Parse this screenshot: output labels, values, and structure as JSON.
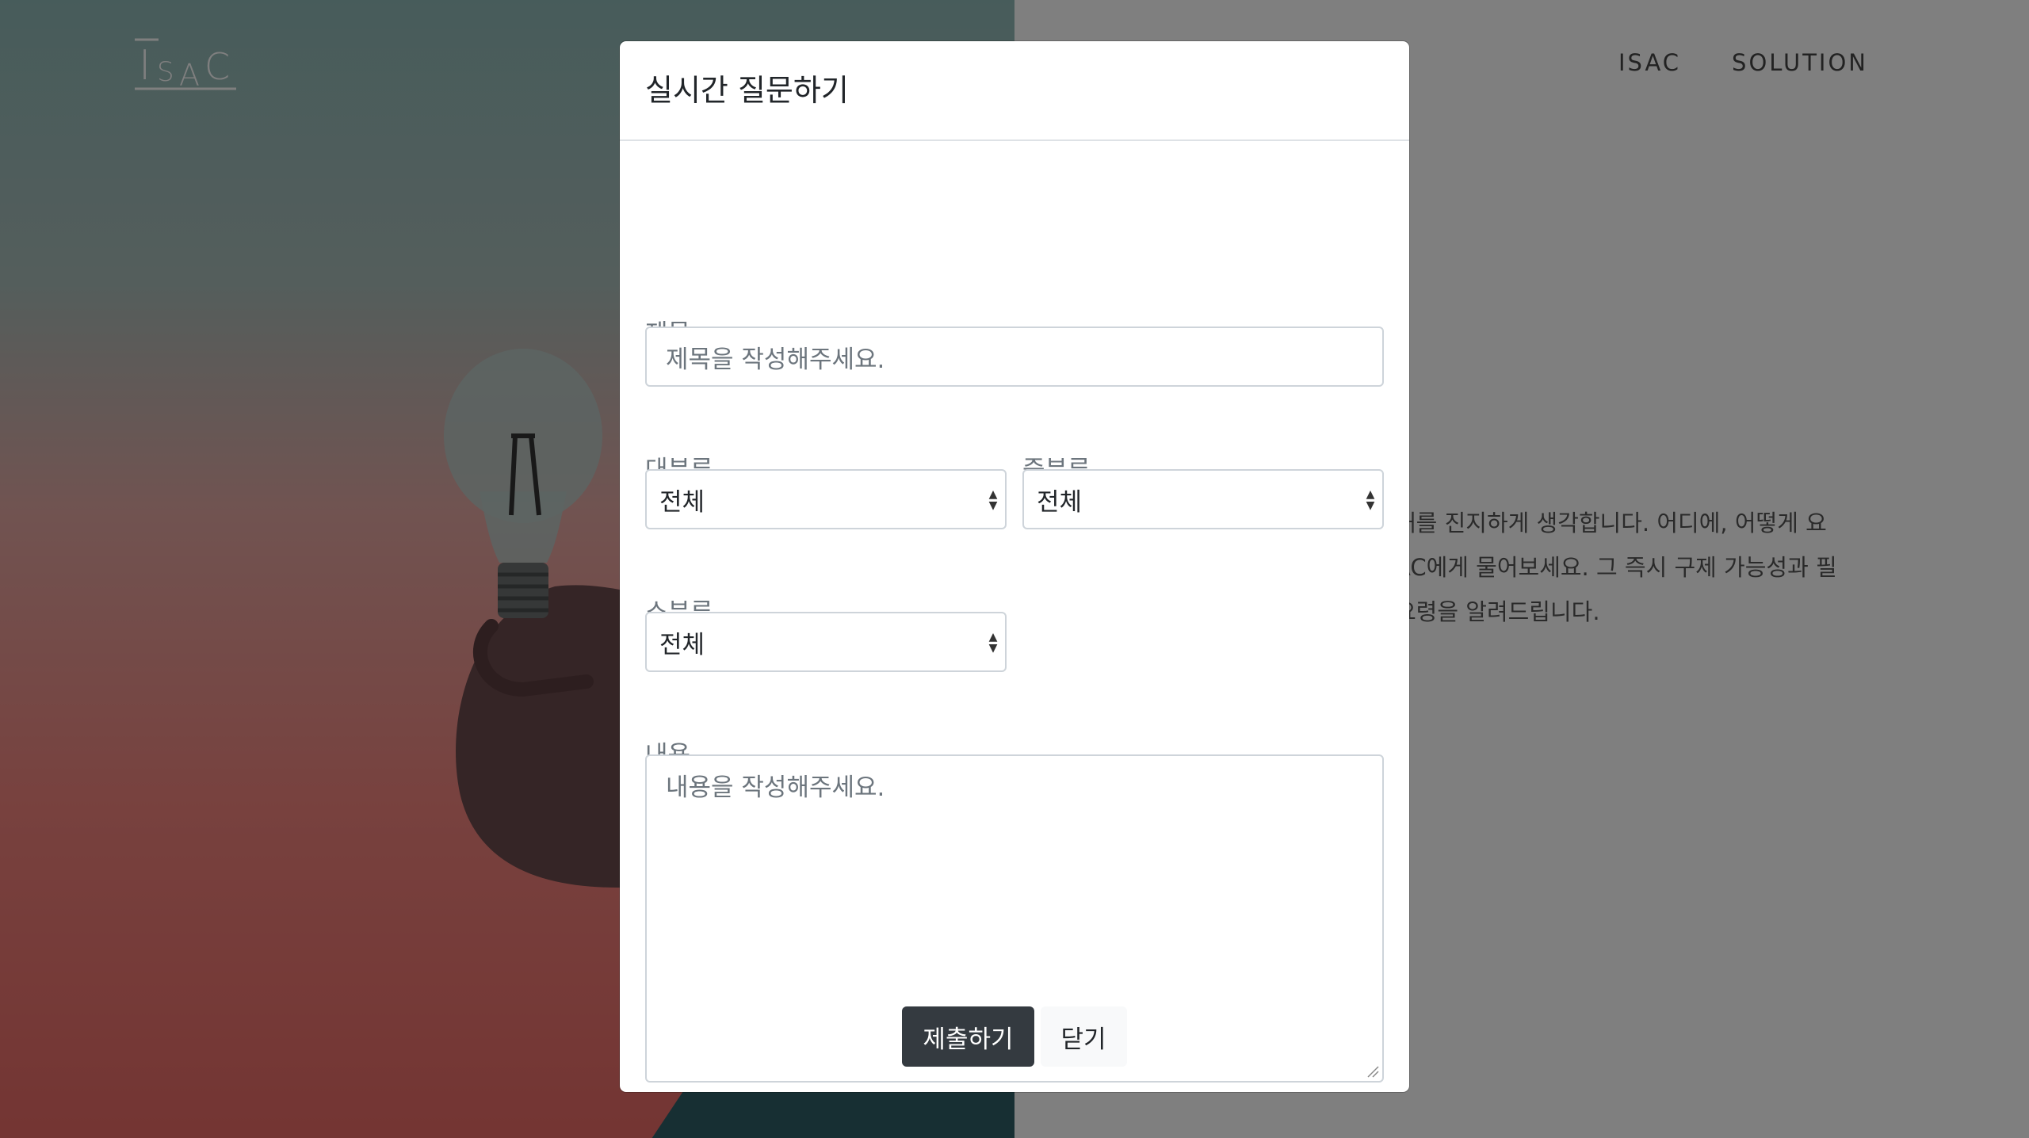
{
  "site": {
    "logo_text": "ISAC",
    "nav": [
      "ISAC",
      "SOLUTION"
    ],
    "hero_lines": [
      "해를 진지하게 생각합니다. 어디에, 어떻게 요",
      "AC에게 물어보세요. 그 즉시 구제 가능성과 필",
      "요령을 알려드립니다."
    ]
  },
  "modal": {
    "title": "실시간 질문하기",
    "title_label": "제목",
    "title_placeholder": "제목을 작성해주세요.",
    "category_major_label": "대분류",
    "category_major_value": "전체",
    "category_middle_label": "중분류",
    "category_middle_value": "전체",
    "category_minor_label": "소분류",
    "category_minor_value": "전체",
    "content_label": "내용",
    "content_placeholder": "내용을 작성해주세요.",
    "submit_label": "제출하기",
    "close_label": "닫기"
  },
  "colors": {
    "primary_button": "#343a40",
    "secondary_button": "#f8f9fa"
  }
}
